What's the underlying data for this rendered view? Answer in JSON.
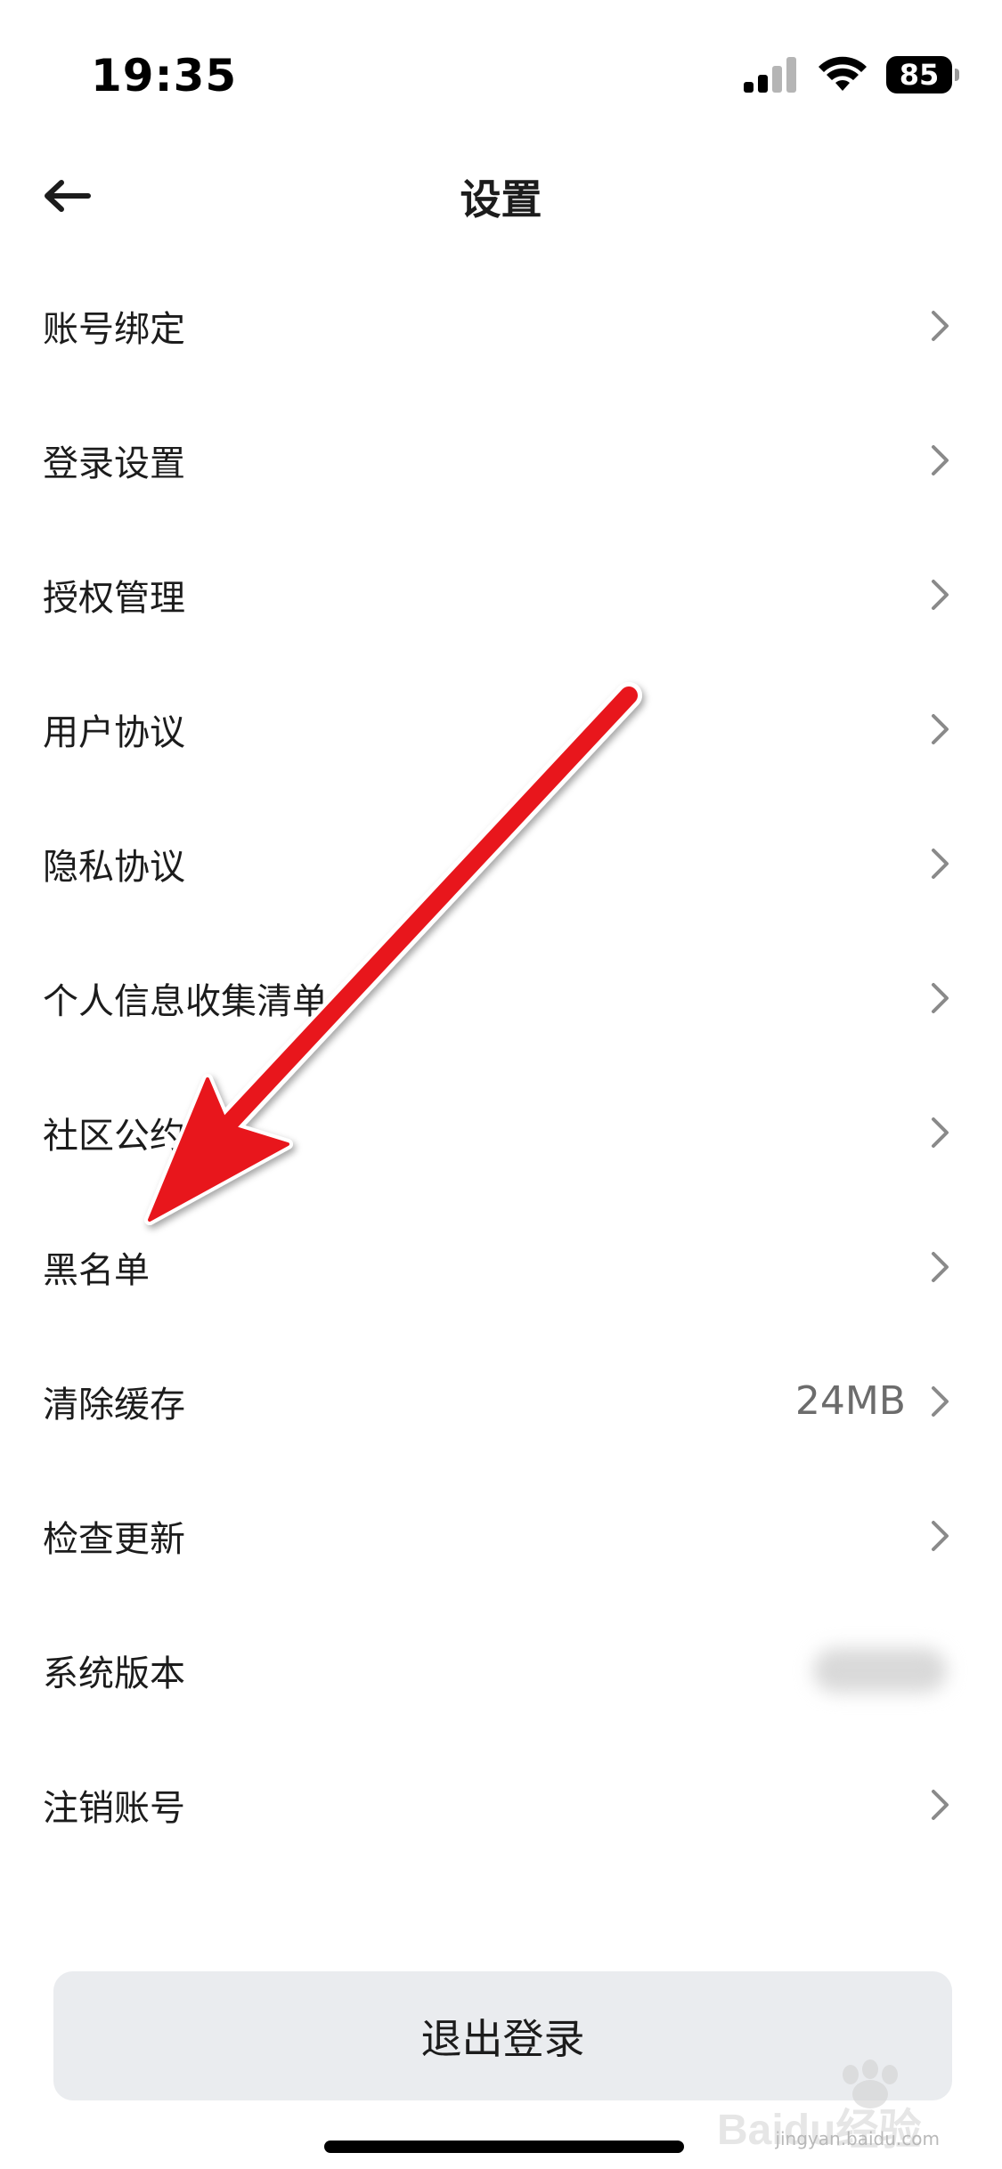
{
  "status_bar": {
    "time": "19:35",
    "battery": "85",
    "icons": [
      "signal-icon",
      "wifi-icon",
      "battery-icon"
    ]
  },
  "header": {
    "title": "设置",
    "back_icon": "arrow-left-icon"
  },
  "settings": {
    "items": [
      {
        "label": "账号绑定"
      },
      {
        "label": "登录设置"
      },
      {
        "label": "授权管理"
      },
      {
        "label": "用户协议"
      },
      {
        "label": "隐私协议"
      },
      {
        "label": "个人信息收集清单"
      },
      {
        "label": "社区公约"
      },
      {
        "label": "黑名单"
      },
      {
        "label": "清除缓存",
        "value": "24MB"
      },
      {
        "label": "检查更新"
      },
      {
        "label": "系统版本"
      },
      {
        "label": "注销账号"
      }
    ]
  },
  "footer": {
    "logout_label": "退出登录"
  },
  "watermark": {
    "text": "Baidu经验",
    "subtext": "jingyan.baidu.com"
  },
  "colors": {
    "annotation_arrow": "#e8141b",
    "logout_bg": "#eaecef",
    "text_primary": "#1c1c1c",
    "text_secondary": "#6c6c6c",
    "chevron": "#8a8a8a"
  }
}
